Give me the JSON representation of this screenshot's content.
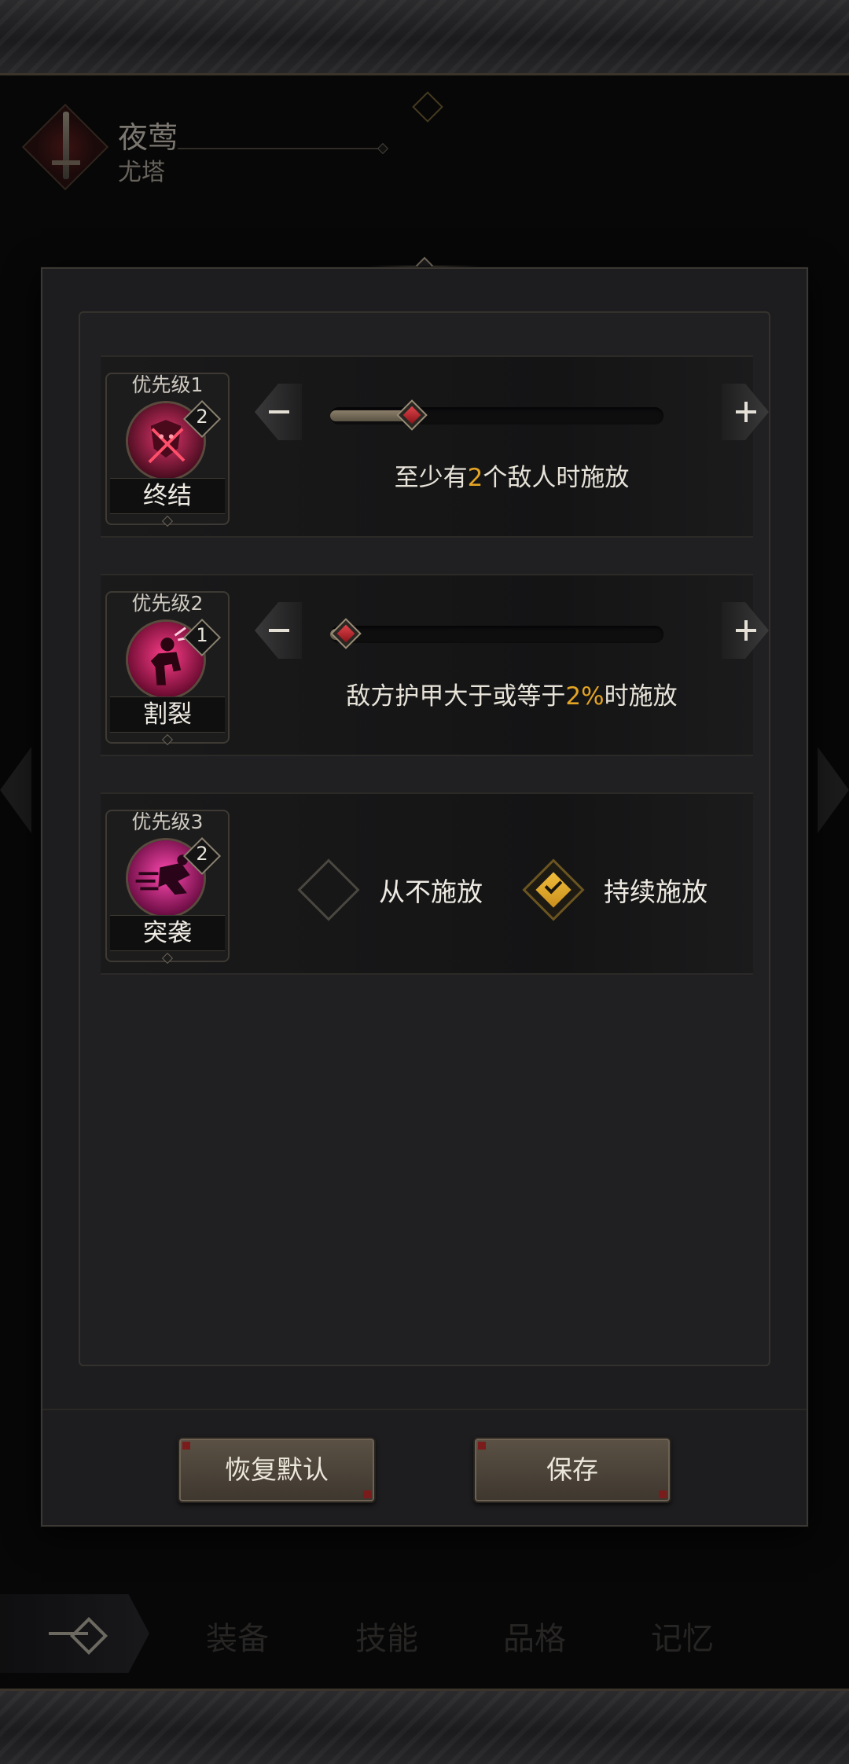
{
  "character": {
    "name": "夜莺",
    "subtitle": "尤塔"
  },
  "skills": [
    {
      "priority": "优先级1",
      "name": "终结",
      "count": "2",
      "control": "slider",
      "slider_fraction": 0.22,
      "desc_prefix": "至少有",
      "desc_value": "2",
      "desc_suffix": "个敌人时施放"
    },
    {
      "priority": "优先级2",
      "name": "割裂",
      "count": "1",
      "control": "slider",
      "slider_fraction": 0.0,
      "desc_prefix": "敌方护甲大于或等于",
      "desc_value": "2%",
      "desc_suffix": "时施放"
    },
    {
      "priority": "优先级3",
      "name": "突袭",
      "count": "2",
      "control": "toggle",
      "options": [
        "从不施放",
        "持续施放"
      ],
      "selected_option": "持续施放"
    }
  ],
  "buttons": {
    "reset": "恢复默认",
    "save": "保存"
  },
  "nav": {
    "tabs": [
      "装备",
      "技能",
      "品格",
      "记忆"
    ]
  },
  "colors": {
    "highlight": "#e4a424",
    "accent_red": "#c02a30",
    "skill_magenta": "#d5126e"
  }
}
